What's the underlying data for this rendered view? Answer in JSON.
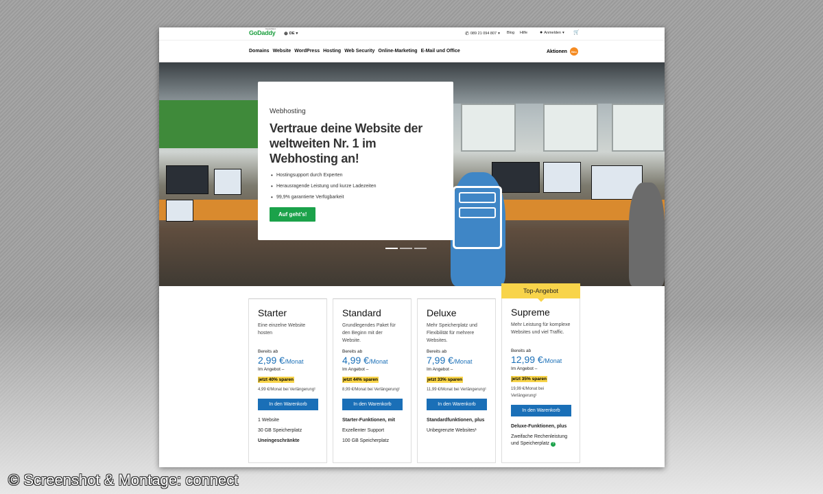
{
  "topbar": {
    "logo": "GoDaddy",
    "logo_sub": "Deutschland",
    "language": "DE",
    "phone": "089 21 094 807",
    "blog": "Blog",
    "help": "Hilfe",
    "login": "Anmelden"
  },
  "nav": {
    "items": [
      "Domains",
      "Website",
      "WordPress",
      "Hosting",
      "Web Security",
      "Online-Marketing",
      "E-Mail und Office"
    ],
    "promo_label": "Aktionen",
    "promo_badge": "Neu"
  },
  "hero": {
    "eyebrow": "Webhosting",
    "headline": "Vertraue deine Website der weltweiten Nr. 1 im Webhosting an!",
    "bullets": [
      "Hostingsupport durch Experten",
      "Herausragende Leistung und kurze Ladezeiten",
      "99,9% garantierte Verfügbarkeit"
    ],
    "cta": "Auf geht's!"
  },
  "plans": [
    {
      "flag": "",
      "name": "Starter",
      "desc": "Eine einzelne Website hosten",
      "from": "Bereits ab",
      "price": "2,99 €",
      "unit": "/Monat",
      "offer": "Im Angebot –",
      "save": "jetzt 40% sparen",
      "renew": "4,99 €/Monat bei Verlängerung¹",
      "button": "In den Warenkorb",
      "features": [
        "1 Website",
        "30 GB Speicherplatz",
        "Uneingeschränkte"
      ]
    },
    {
      "flag": "",
      "name": "Standard",
      "desc": "Grundlegendes Paket für den Beginn mit der Website.",
      "from": "Bereits ab",
      "price": "4,99 €",
      "unit": "/Monat",
      "offer": "Im Angebot –",
      "save": "jetzt 44% sparen",
      "renew": "8,99 €/Monat bei Verlängerung¹",
      "button": "In den Warenkorb",
      "features": [
        "Starter-Funktionen, mit",
        "Exzellenter Support",
        "100 GB Speicherplatz"
      ]
    },
    {
      "flag": "",
      "name": "Deluxe",
      "desc": "Mehr Speicherplatz und Flexibilität für mehrere Websites.",
      "from": "Bereits ab",
      "price": "7,99 €",
      "unit": "/Monat",
      "offer": "Im Angebot –",
      "save": "jetzt 33% sparen",
      "renew": "11,99 €/Monat bei Verlängerung¹",
      "button": "In den Warenkorb",
      "features": [
        "Standardfunktionen, plus",
        "Unbegrenzte Websites¹"
      ]
    },
    {
      "flag": "Top-Angebot",
      "name": "Supreme",
      "desc": "Mehr Leistung für komplexe Websites und viel Traffic.",
      "from": "Bereits ab",
      "price": "12,99 €",
      "unit": "/Monat",
      "offer": "Im Angebot –",
      "save": "jetzt 35% sparen",
      "renew": "19,99 €/Monat bei Verlängerung¹",
      "button": "In den Warenkorb",
      "features": [
        "Deluxe-Funktionen, plus",
        "Zweifache Rechenleistung und Speicherplatz"
      ]
    }
  ],
  "watermark": "© Screenshot & Montage: connect",
  "colors": {
    "brand_green": "#1ba24a",
    "blue": "#1a6fb7",
    "highlight": "#f8d44a",
    "promo_orange": "#f58b22"
  }
}
